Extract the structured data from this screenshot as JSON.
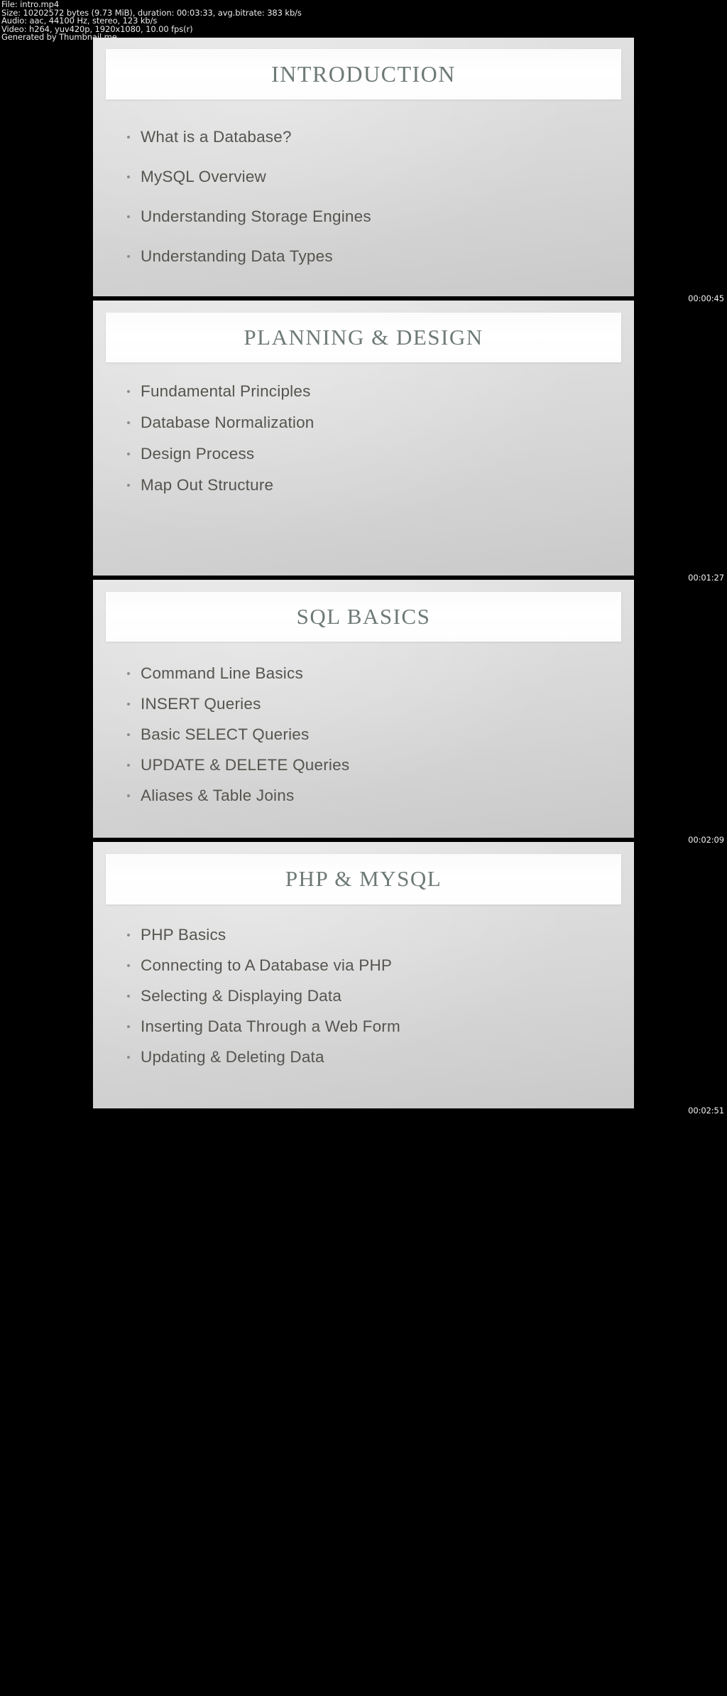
{
  "metadata": {
    "lines": [
      "File: intro.mp4",
      "Size: 10202572 bytes (9.73 MiB), duration: 00:03:33, avg.bitrate: 383 kb/s",
      "Audio: aac, 44100 Hz, stereo, 123 kb/s",
      "Video: h264, yuv420p, 1920x1080, 10.00 fps(r)",
      "Generated by Thumbnail me"
    ],
    "file_label": "File: intro.mp4",
    "size_label": "Size: 10202572 bytes (9.73 MiB), duration: 00:03:33, avg.bitrate: 383 kb/s",
    "audio_label": "Audio: aac, 44100 Hz, stereo, 123 kb/s",
    "video_label": "Video: h264, yuv420p, 1920x1080, 10.00 fps(r)",
    "generator_label": "Generated by Thumbnail me"
  },
  "colors": {
    "background": "#000000",
    "slide_background": "#dedede",
    "title_plate": "#ffffff",
    "title_text": "#6e7a77",
    "bullet_text": "#56544f",
    "bullet_dot": "#8e8c86",
    "timestamp_text": "#f2f2f2"
  },
  "thumbnails": [
    {
      "timestamp": "00:00:45",
      "title": "INTRODUCTION",
      "bullets": [
        "What is a Database?",
        "MySQL Overview",
        "Understanding Storage Engines",
        "Understanding Data Types"
      ]
    },
    {
      "timestamp": "00:01:27",
      "title": "PLANNING & DESIGN",
      "bullets": [
        "Fundamental Principles",
        "Database Normalization",
        "Design Process",
        "Map Out Structure"
      ]
    },
    {
      "timestamp": "00:02:09",
      "title": "SQL BASICS",
      "bullets": [
        "Command Line Basics",
        "INSERT Queries",
        "Basic SELECT Queries",
        "UPDATE & DELETE Queries",
        "Aliases & Table Joins"
      ]
    },
    {
      "timestamp": "00:02:51",
      "title": "PHP & MYSQL",
      "bullets": [
        "PHP Basics",
        "Connecting to A Database via PHP",
        "Selecting & Displaying Data",
        "Inserting Data Through a Web Form",
        "Updating & Deleting Data"
      ]
    }
  ]
}
